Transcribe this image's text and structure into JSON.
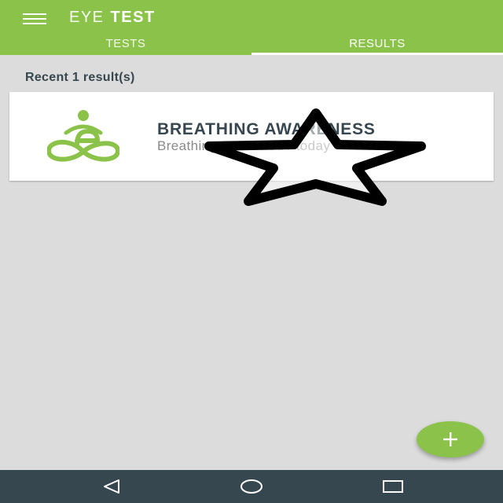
{
  "appbar": {
    "title_light": "EYE",
    "title_bold": "TEST",
    "background": "#8bc34a",
    "tabs": [
      {
        "label": "TESTS",
        "selected": false
      },
      {
        "label": "RESULTS",
        "selected": true
      }
    ]
  },
  "results": {
    "header": "Recent 1 result(s)",
    "items": [
      {
        "title": "BREATHING AWARENESS",
        "subtitle": "Breathing Seasoned / today",
        "icon": "meditation-icon"
      }
    ]
  },
  "overlay": {
    "icon": "star-outline-icon"
  },
  "fab": {
    "icon": "plus-icon",
    "color": "#8bc34a"
  },
  "navbar": {
    "background": "#37474f",
    "buttons": [
      "back-icon",
      "home-icon",
      "recent-apps-icon"
    ]
  }
}
